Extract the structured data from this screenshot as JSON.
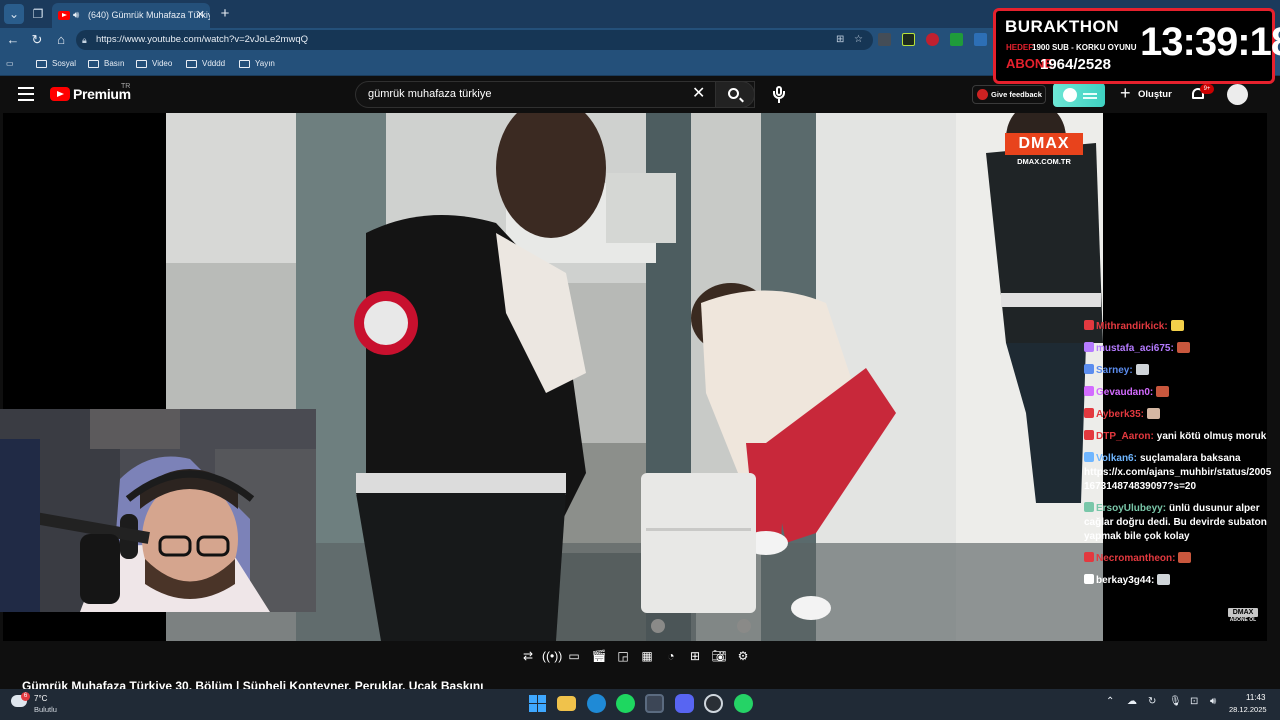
{
  "browser": {
    "tab_title": "(640) Gümrük Muhafaza Türkiye",
    "url": "https://www.youtube.com/watch?v=2vJoLe2mwqQ",
    "bookmarks": [
      "Sosyal",
      "Basın",
      "Video",
      "Vdddd",
      "Yayın"
    ]
  },
  "youtube": {
    "brand": "Premium",
    "region": "TR",
    "search_value": "gümrük muhafaza türkiye",
    "feedback_label": "Give feedback",
    "create_label": "Oluştur",
    "notifications_badge": "9+",
    "video_title": "Gümrük Muhafaza Türkiye 30. Bölüm | Şüpheli Konteyner, Peruklar, Uçak Baskını"
  },
  "overlay": {
    "title": "BURAKTHON",
    "goal_label": "HEDEF:",
    "goal_value": "1900 SUB - KORKU OYUNU",
    "sub_label": "ABONE",
    "sub_value": "1964/2528",
    "clock": "13:39:18"
  },
  "video": {
    "channel_logo": "DMAX",
    "channel_url": "DMAX.COM.TR",
    "subscribe_logo": "DMAX",
    "subscribe_text": "ABONE OL"
  },
  "chat": [
    {
      "user": "Mithrandirkick:",
      "color": "#e3393f",
      "text": "",
      "emote": "#f3d04a"
    },
    {
      "user": "mustafa_aci675:",
      "color": "#b57bff",
      "text": "",
      "emote": "#c8573d"
    },
    {
      "user": "Sarney:",
      "color": "#5b8def",
      "text": "",
      "emote": "#cfd4d8"
    },
    {
      "user": "Gevaudan0:",
      "color": "#d36bff",
      "text": "",
      "emote": "#c8573d"
    },
    {
      "user": "Ayberk35:",
      "color": "#e3393f",
      "text": "",
      "emote": "#d5b7a3"
    },
    {
      "user": "DTP_Aaron:",
      "color": "#e3393f",
      "text": "yani kötü olmuş moruk",
      "emote": ""
    },
    {
      "user": "Volkan6:",
      "color": "#6fb6ff",
      "text": "suçlamalara baksana https://x.com/ajans_muhbir/status/2005167314874839097?s=20",
      "emote": ""
    },
    {
      "user": "ErsoyUlubeyy:",
      "color": "#79c7a9",
      "text": "ünlü dusunur alper cağlar doğru dedi. Bu devirde subaton yapmak bile çok kolay",
      "emote": ""
    },
    {
      "user": "Necromantheon:",
      "color": "#e3393f",
      "text": "",
      "emote": "#c8573d"
    },
    {
      "user": "berkay3g44:",
      "color": "#ffffff",
      "text": "",
      "emote": "#cfd4d8"
    }
  ],
  "taskbar": {
    "temperature": "7°C",
    "weather": "Bulutlu",
    "weather_badge": "6",
    "time": "11:43",
    "date": "28.12.2025"
  }
}
